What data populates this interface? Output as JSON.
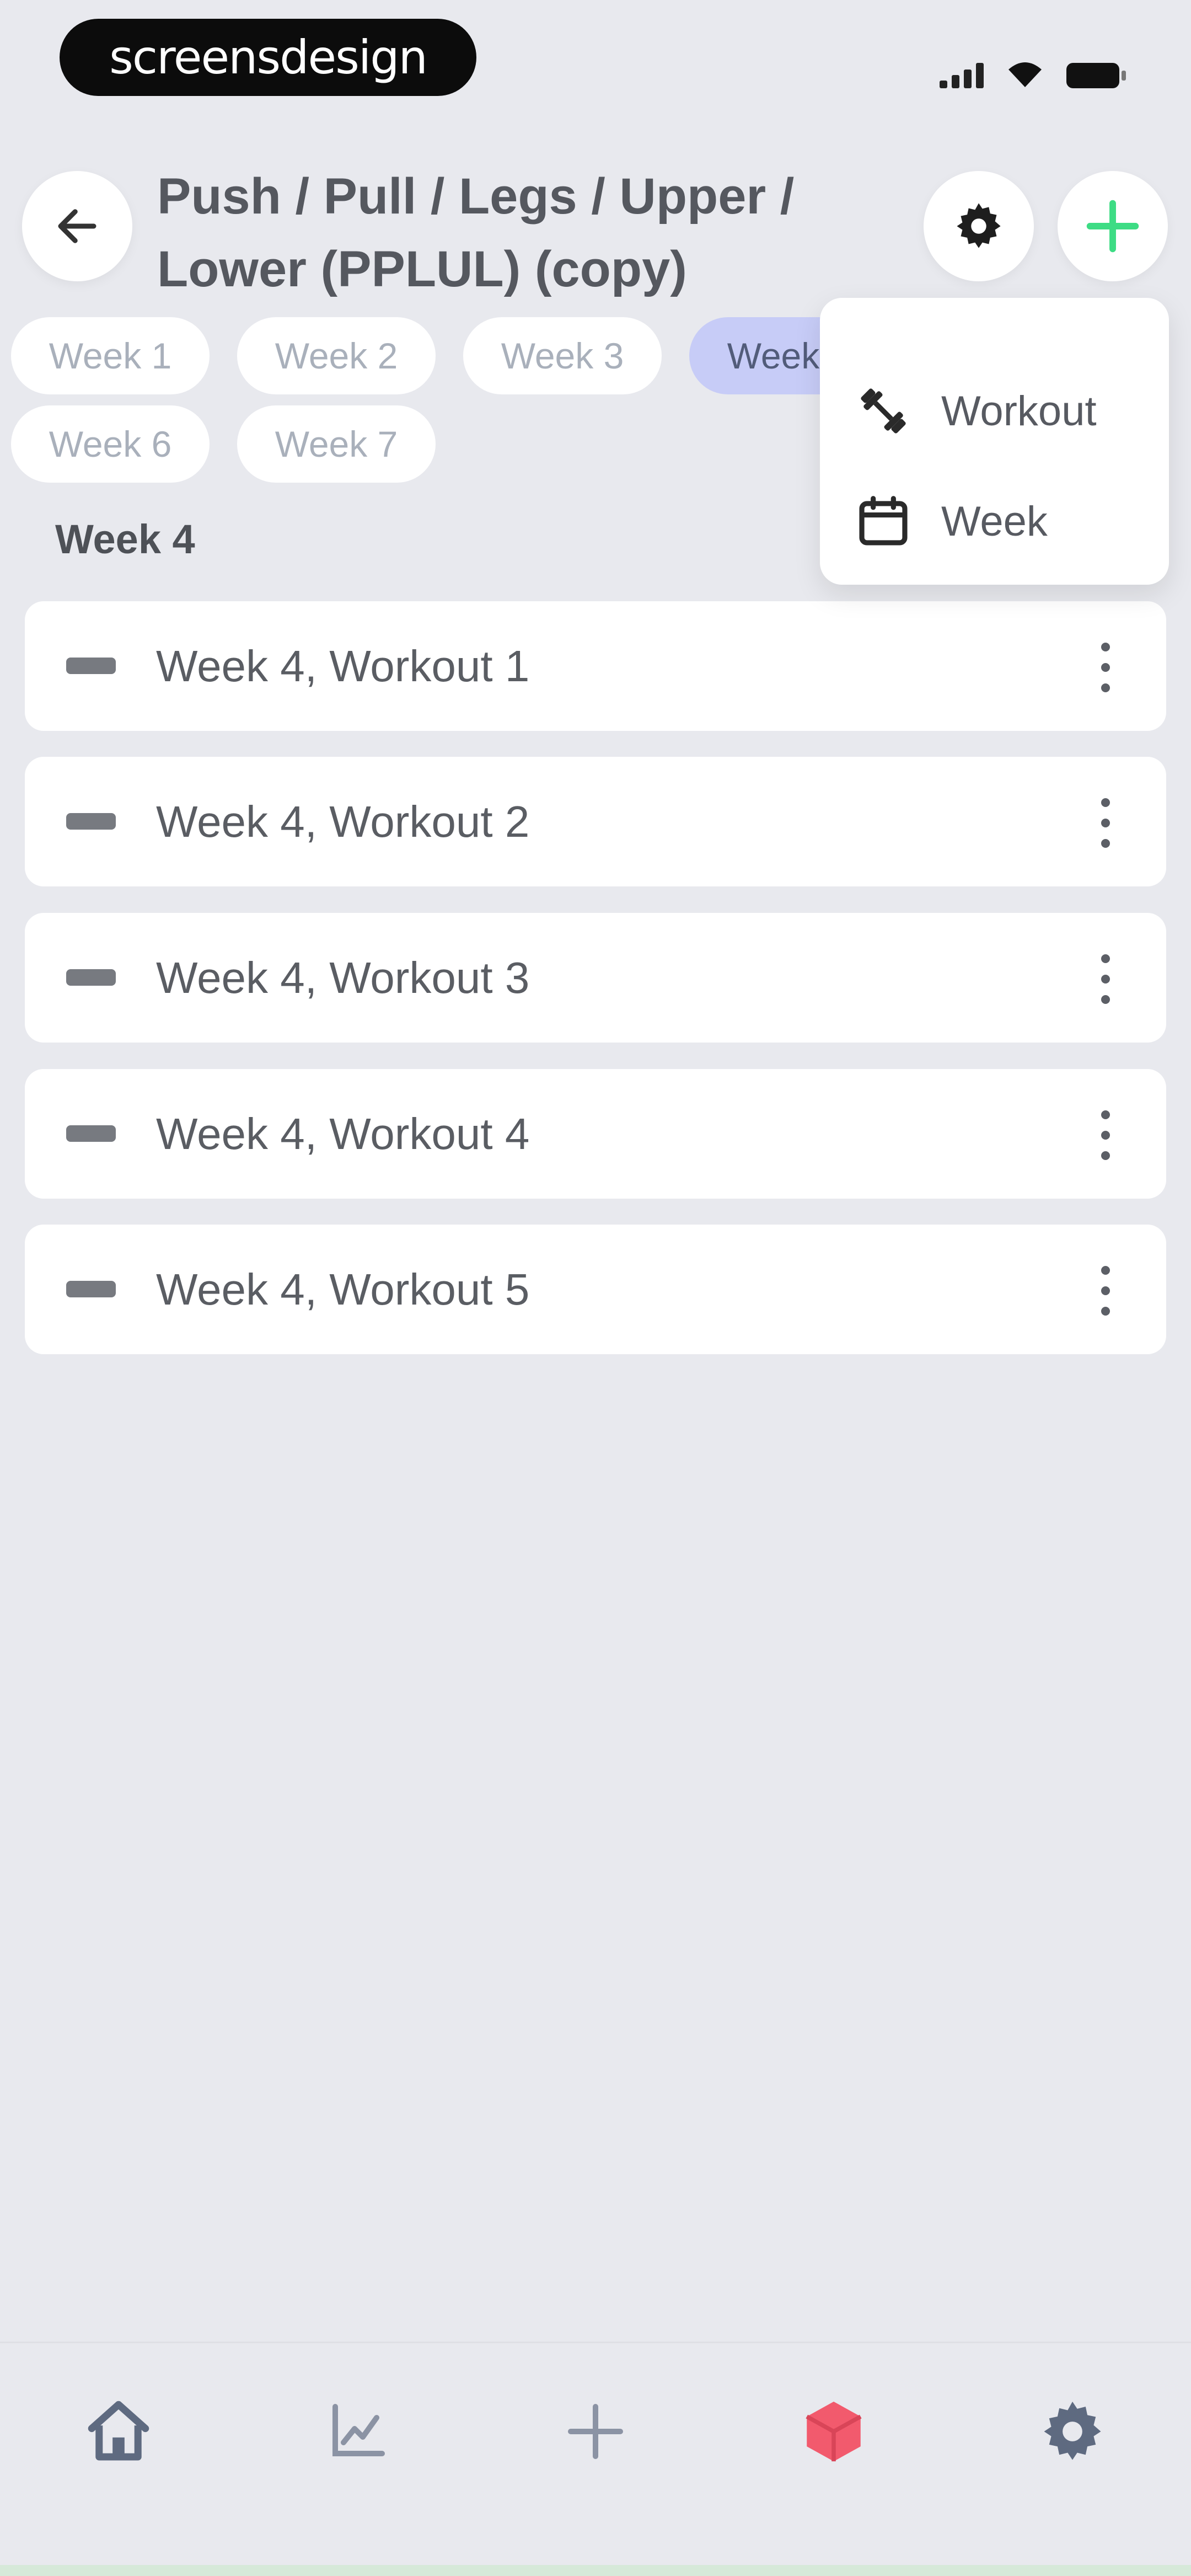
{
  "status_bar": {
    "brand": "screensdesign"
  },
  "header": {
    "title": "Push / Pull / Legs / Upper / Lower (PPLUL) (copy)"
  },
  "weeks": {
    "chips": [
      "Week 1",
      "Week 2",
      "Week 3",
      "Week 4",
      "Week 6",
      "Week 7"
    ],
    "active_chip": "Week 4"
  },
  "section": {
    "title": "Week 4"
  },
  "workouts": [
    {
      "label": "Week 4, Workout 1"
    },
    {
      "label": "Week 4, Workout 2"
    },
    {
      "label": "Week 4, Workout 3"
    },
    {
      "label": "Week 4, Workout 4"
    },
    {
      "label": "Week 4, Workout 5"
    }
  ],
  "add_menu": {
    "items": [
      {
        "label": "Workout",
        "icon": "dumbbell-icon"
      },
      {
        "label": "Week",
        "icon": "calendar-icon"
      }
    ]
  },
  "bottom_nav": {
    "items": [
      {
        "icon": "home-icon"
      },
      {
        "icon": "chart-icon"
      },
      {
        "icon": "plus-icon"
      },
      {
        "icon": "cube-icon",
        "active": true
      },
      {
        "icon": "gear-icon"
      }
    ]
  },
  "colors": {
    "background": "#e8e9ee",
    "accent_green": "#3ddc84",
    "active_chip": "#c7ccf7",
    "active_nav": "#f25a6d"
  }
}
